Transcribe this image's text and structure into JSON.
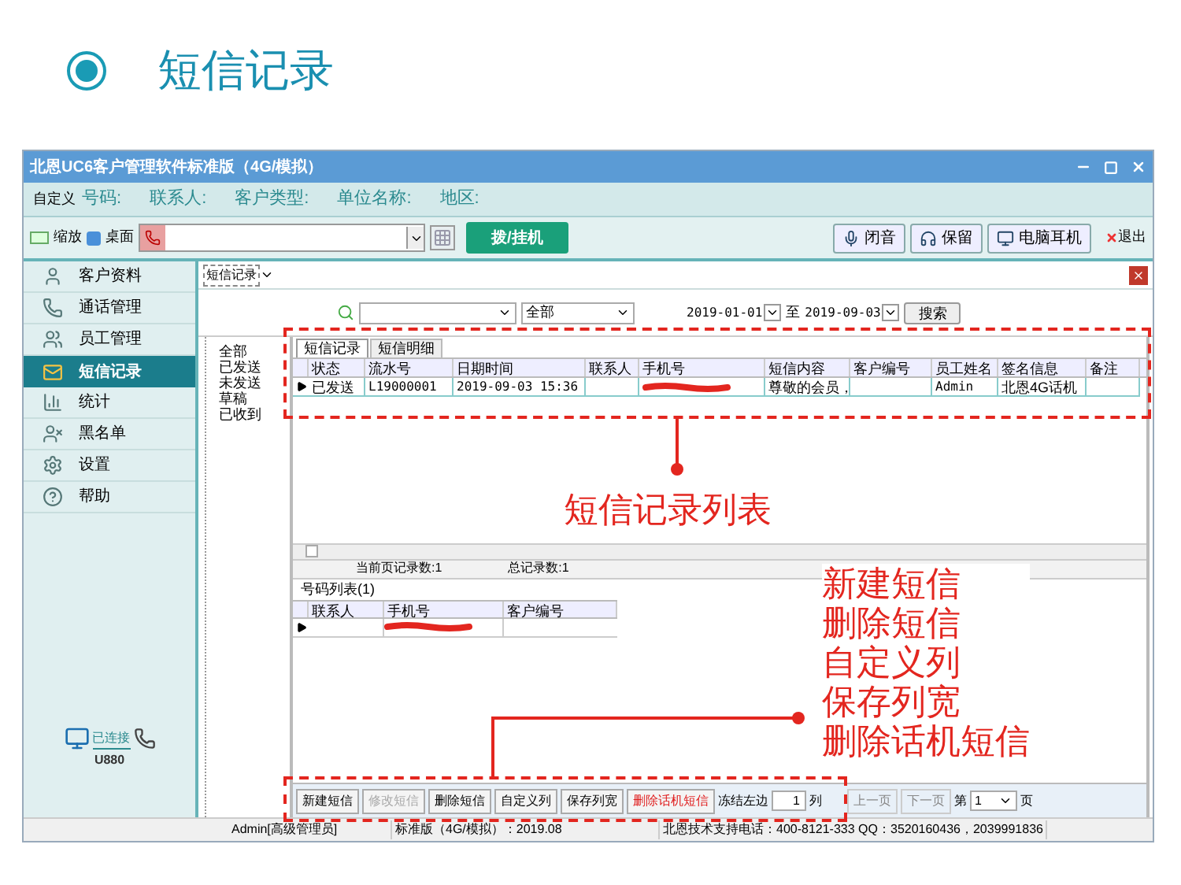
{
  "page_title": "短信记录",
  "window": {
    "title": "北恩UC6客户管理软件标准版（4G/模拟）"
  },
  "search": {
    "custom": "自定义",
    "fields": [
      "号码:",
      "联系人:",
      "客户类型:",
      "单位名称:",
      "地区:"
    ]
  },
  "toolbar": {
    "zoom": "缩放",
    "desktop": "桌面",
    "dial_button": "拨/挂机",
    "buttons": [
      "闭音",
      "保留",
      "电脑耳机"
    ],
    "exit": "退出"
  },
  "sidebar": {
    "items": [
      {
        "label": "客户资料",
        "selected": false
      },
      {
        "label": "通话管理",
        "selected": false
      },
      {
        "label": "员工管理",
        "selected": false
      },
      {
        "label": "短信记录",
        "selected": true
      },
      {
        "label": "统计",
        "selected": false
      },
      {
        "label": "黑名单",
        "selected": false
      },
      {
        "label": "设置",
        "selected": false
      },
      {
        "label": "帮助",
        "selected": false
      }
    ],
    "connection": {
      "status": "已连接",
      "device": "U880"
    }
  },
  "doc_tab": "短信记录",
  "filter": {
    "type_value": "全部",
    "date_from": "2019-01-01",
    "to": "至",
    "date_to": "2019-09-03",
    "search_button": "搜索"
  },
  "tree": [
    "全部",
    "已发送",
    "未发送",
    "草稿",
    "已收到"
  ],
  "inner_tabs": [
    {
      "label": "短信记录",
      "selected": true
    },
    {
      "label": "短信明细",
      "selected": false
    }
  ],
  "table": {
    "columns": [
      "状态",
      "流水号",
      "日期时间",
      "联系人",
      "手机号",
      "短信内容",
      "客户编号",
      "员工姓名",
      "签名信息",
      "备注"
    ],
    "rows": [
      {
        "selected": true,
        "status": "已发送",
        "serial": "L19000001",
        "datetime": "2019-09-03 15:36",
        "phone_redacted": true,
        "content": "尊敬的会员，",
        "employee": "Admin",
        "signature": "北恩4G话机"
      }
    ]
  },
  "counts": {
    "page": "当前页记录数:1",
    "total": "总记录数:1"
  },
  "number_list": {
    "title": "号码列表(1)",
    "columns": [
      "联系人",
      "手机号",
      "客户编号"
    ],
    "rows": [
      {
        "selected": true,
        "phone_redacted": true
      }
    ]
  },
  "bottom_buttons": [
    {
      "label": "新建短信",
      "disabled": false,
      "kind": "normal"
    },
    {
      "label": "修改短信",
      "disabled": true,
      "kind": "normal"
    },
    {
      "label": "删除短信",
      "disabled": false,
      "kind": "normal"
    },
    {
      "label": "自定义列",
      "disabled": false,
      "kind": "normal"
    },
    {
      "label": "保存列宽",
      "disabled": false,
      "kind": "normal"
    },
    {
      "label": "删除话机短信",
      "disabled": false,
      "kind": "danger"
    }
  ],
  "freeze": {
    "label": "冻结左边",
    "value": "1",
    "unit": "列"
  },
  "pager": {
    "prev": "上一页",
    "prev_disabled": true,
    "next": "下一页",
    "next_disabled": true,
    "prefix": "第",
    "page": "1",
    "suffix": "页"
  },
  "status_bar": [
    "Admin[高级管理员]",
    "标准版（4G/模拟）：2019.08",
    "北恩技术支持电话：400-8121-333  QQ：3520160436，2039991836"
  ],
  "annotations": {
    "list_label": "短信记录列表",
    "button_labels": [
      "新建短信",
      "删除短信",
      "自定义列",
      "保存列宽",
      "删除话机短信"
    ]
  }
}
